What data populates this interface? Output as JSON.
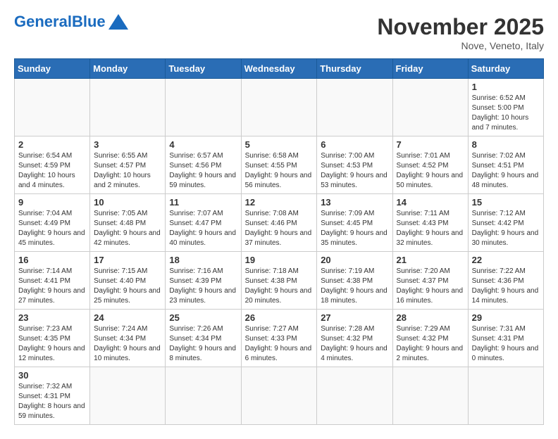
{
  "header": {
    "logo_general": "General",
    "logo_blue": "Blue",
    "month_year": "November 2025",
    "location": "Nove, Veneto, Italy"
  },
  "weekdays": [
    "Sunday",
    "Monday",
    "Tuesday",
    "Wednesday",
    "Thursday",
    "Friday",
    "Saturday"
  ],
  "weeks": [
    [
      {
        "day": "",
        "info": ""
      },
      {
        "day": "",
        "info": ""
      },
      {
        "day": "",
        "info": ""
      },
      {
        "day": "",
        "info": ""
      },
      {
        "day": "",
        "info": ""
      },
      {
        "day": "",
        "info": ""
      },
      {
        "day": "1",
        "info": "Sunrise: 6:52 AM\nSunset: 5:00 PM\nDaylight: 10 hours and 7 minutes."
      }
    ],
    [
      {
        "day": "2",
        "info": "Sunrise: 6:54 AM\nSunset: 4:59 PM\nDaylight: 10 hours and 4 minutes."
      },
      {
        "day": "3",
        "info": "Sunrise: 6:55 AM\nSunset: 4:57 PM\nDaylight: 10 hours and 2 minutes."
      },
      {
        "day": "4",
        "info": "Sunrise: 6:57 AM\nSunset: 4:56 PM\nDaylight: 9 hours and 59 minutes."
      },
      {
        "day": "5",
        "info": "Sunrise: 6:58 AM\nSunset: 4:55 PM\nDaylight: 9 hours and 56 minutes."
      },
      {
        "day": "6",
        "info": "Sunrise: 7:00 AM\nSunset: 4:53 PM\nDaylight: 9 hours and 53 minutes."
      },
      {
        "day": "7",
        "info": "Sunrise: 7:01 AM\nSunset: 4:52 PM\nDaylight: 9 hours and 50 minutes."
      },
      {
        "day": "8",
        "info": "Sunrise: 7:02 AM\nSunset: 4:51 PM\nDaylight: 9 hours and 48 minutes."
      }
    ],
    [
      {
        "day": "9",
        "info": "Sunrise: 7:04 AM\nSunset: 4:49 PM\nDaylight: 9 hours and 45 minutes."
      },
      {
        "day": "10",
        "info": "Sunrise: 7:05 AM\nSunset: 4:48 PM\nDaylight: 9 hours and 42 minutes."
      },
      {
        "day": "11",
        "info": "Sunrise: 7:07 AM\nSunset: 4:47 PM\nDaylight: 9 hours and 40 minutes."
      },
      {
        "day": "12",
        "info": "Sunrise: 7:08 AM\nSunset: 4:46 PM\nDaylight: 9 hours and 37 minutes."
      },
      {
        "day": "13",
        "info": "Sunrise: 7:09 AM\nSunset: 4:45 PM\nDaylight: 9 hours and 35 minutes."
      },
      {
        "day": "14",
        "info": "Sunrise: 7:11 AM\nSunset: 4:43 PM\nDaylight: 9 hours and 32 minutes."
      },
      {
        "day": "15",
        "info": "Sunrise: 7:12 AM\nSunset: 4:42 PM\nDaylight: 9 hours and 30 minutes."
      }
    ],
    [
      {
        "day": "16",
        "info": "Sunrise: 7:14 AM\nSunset: 4:41 PM\nDaylight: 9 hours and 27 minutes."
      },
      {
        "day": "17",
        "info": "Sunrise: 7:15 AM\nSunset: 4:40 PM\nDaylight: 9 hours and 25 minutes."
      },
      {
        "day": "18",
        "info": "Sunrise: 7:16 AM\nSunset: 4:39 PM\nDaylight: 9 hours and 23 minutes."
      },
      {
        "day": "19",
        "info": "Sunrise: 7:18 AM\nSunset: 4:38 PM\nDaylight: 9 hours and 20 minutes."
      },
      {
        "day": "20",
        "info": "Sunrise: 7:19 AM\nSunset: 4:38 PM\nDaylight: 9 hours and 18 minutes."
      },
      {
        "day": "21",
        "info": "Sunrise: 7:20 AM\nSunset: 4:37 PM\nDaylight: 9 hours and 16 minutes."
      },
      {
        "day": "22",
        "info": "Sunrise: 7:22 AM\nSunset: 4:36 PM\nDaylight: 9 hours and 14 minutes."
      }
    ],
    [
      {
        "day": "23",
        "info": "Sunrise: 7:23 AM\nSunset: 4:35 PM\nDaylight: 9 hours and 12 minutes."
      },
      {
        "day": "24",
        "info": "Sunrise: 7:24 AM\nSunset: 4:34 PM\nDaylight: 9 hours and 10 minutes."
      },
      {
        "day": "25",
        "info": "Sunrise: 7:26 AM\nSunset: 4:34 PM\nDaylight: 9 hours and 8 minutes."
      },
      {
        "day": "26",
        "info": "Sunrise: 7:27 AM\nSunset: 4:33 PM\nDaylight: 9 hours and 6 minutes."
      },
      {
        "day": "27",
        "info": "Sunrise: 7:28 AM\nSunset: 4:32 PM\nDaylight: 9 hours and 4 minutes."
      },
      {
        "day": "28",
        "info": "Sunrise: 7:29 AM\nSunset: 4:32 PM\nDaylight: 9 hours and 2 minutes."
      },
      {
        "day": "29",
        "info": "Sunrise: 7:31 AM\nSunset: 4:31 PM\nDaylight: 9 hours and 0 minutes."
      }
    ],
    [
      {
        "day": "30",
        "info": "Sunrise: 7:32 AM\nSunset: 4:31 PM\nDaylight: 8 hours and 59 minutes."
      },
      {
        "day": "",
        "info": ""
      },
      {
        "day": "",
        "info": ""
      },
      {
        "day": "",
        "info": ""
      },
      {
        "day": "",
        "info": ""
      },
      {
        "day": "",
        "info": ""
      },
      {
        "day": "",
        "info": ""
      }
    ]
  ]
}
